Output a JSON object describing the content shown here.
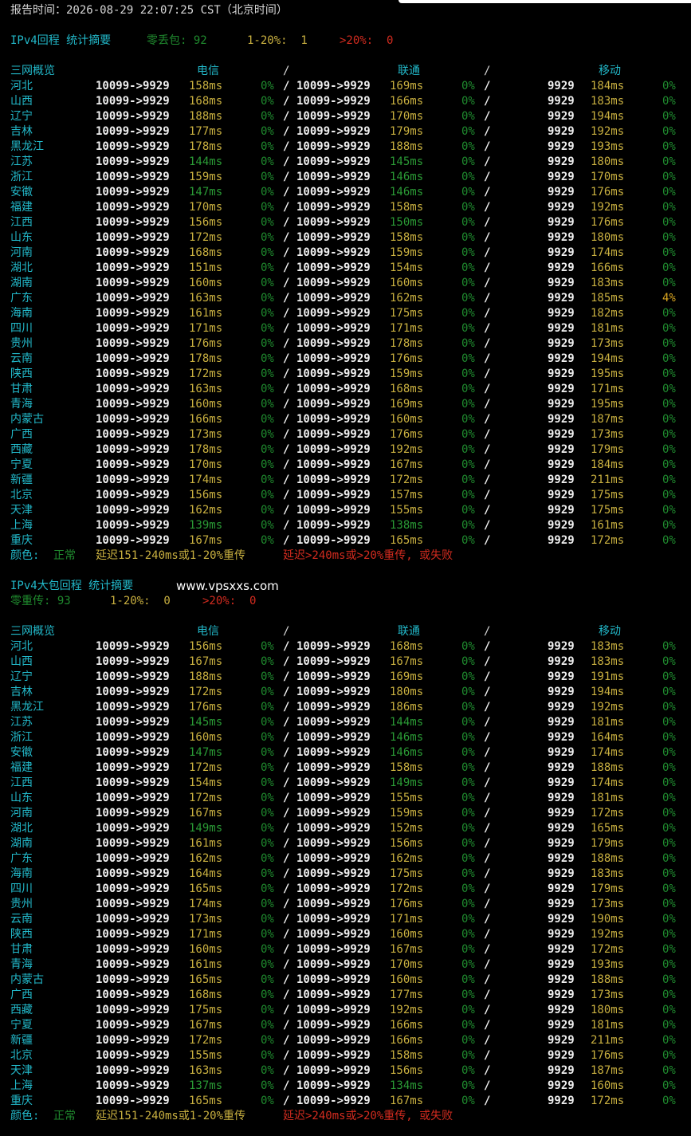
{
  "report_time": "报告时间：2026-08-29 22:07:25 CST（北京时间）",
  "section1": {
    "title": "IPv4回程 统计摘要",
    "stats": [
      {
        "label": "零丢包: 92",
        "color": "green"
      },
      {
        "label": "1-20%:  1",
        "color": "yellow"
      },
      {
        "label": ">20%:  0",
        "color": "red"
      }
    ],
    "header": {
      "region": "三网概览",
      "telecom": "电信",
      "sep1": "/",
      "unicom": "联通",
      "sep2": "/",
      "mobile": "移动"
    },
    "rows": [
      [
        "河北",
        "10099->9929",
        "158ms",
        "0%",
        "10099->9929",
        "169ms",
        "0%",
        "9929",
        "184ms",
        "0%"
      ],
      [
        "山西",
        "10099->9929",
        "168ms",
        "0%",
        "10099->9929",
        "166ms",
        "0%",
        "9929",
        "183ms",
        "0%"
      ],
      [
        "辽宁",
        "10099->9929",
        "188ms",
        "0%",
        "10099->9929",
        "170ms",
        "0%",
        "9929",
        "194ms",
        "0%"
      ],
      [
        "吉林",
        "10099->9929",
        "177ms",
        "0%",
        "10099->9929",
        "179ms",
        "0%",
        "9929",
        "192ms",
        "0%"
      ],
      [
        "黑龙江",
        "10099->9929",
        "178ms",
        "0%",
        "10099->9929",
        "188ms",
        "0%",
        "9929",
        "193ms",
        "0%"
      ],
      [
        "江苏",
        "10099->9929",
        "144ms",
        "0%",
        "10099->9929",
        "145ms",
        "0%",
        "9929",
        "180ms",
        "0%"
      ],
      [
        "浙江",
        "10099->9929",
        "159ms",
        "0%",
        "10099->9929",
        "146ms",
        "0%",
        "9929",
        "170ms",
        "0%"
      ],
      [
        "安徽",
        "10099->9929",
        "147ms",
        "0%",
        "10099->9929",
        "146ms",
        "0%",
        "9929",
        "176ms",
        "0%"
      ],
      [
        "福建",
        "10099->9929",
        "170ms",
        "0%",
        "10099->9929",
        "158ms",
        "0%",
        "9929",
        "192ms",
        "0%"
      ],
      [
        "江西",
        "10099->9929",
        "156ms",
        "0%",
        "10099->9929",
        "150ms",
        "0%",
        "9929",
        "176ms",
        "0%"
      ],
      [
        "山东",
        "10099->9929",
        "172ms",
        "0%",
        "10099->9929",
        "158ms",
        "0%",
        "9929",
        "180ms",
        "0%"
      ],
      [
        "河南",
        "10099->9929",
        "168ms",
        "0%",
        "10099->9929",
        "159ms",
        "0%",
        "9929",
        "174ms",
        "0%"
      ],
      [
        "湖北",
        "10099->9929",
        "151ms",
        "0%",
        "10099->9929",
        "154ms",
        "0%",
        "9929",
        "166ms",
        "0%"
      ],
      [
        "湖南",
        "10099->9929",
        "160ms",
        "0%",
        "10099->9929",
        "160ms",
        "0%",
        "9929",
        "183ms",
        "0%"
      ],
      [
        "广东",
        "10099->9929",
        "163ms",
        "0%",
        "10099->9929",
        "162ms",
        "0%",
        "9929",
        "185ms",
        "4%"
      ],
      [
        "海南",
        "10099->9929",
        "161ms",
        "0%",
        "10099->9929",
        "175ms",
        "0%",
        "9929",
        "182ms",
        "0%"
      ],
      [
        "四川",
        "10099->9929",
        "171ms",
        "0%",
        "10099->9929",
        "171ms",
        "0%",
        "9929",
        "181ms",
        "0%"
      ],
      [
        "贵州",
        "10099->9929",
        "176ms",
        "0%",
        "10099->9929",
        "178ms",
        "0%",
        "9929",
        "173ms",
        "0%"
      ],
      [
        "云南",
        "10099->9929",
        "178ms",
        "0%",
        "10099->9929",
        "176ms",
        "0%",
        "9929",
        "194ms",
        "0%"
      ],
      [
        "陕西",
        "10099->9929",
        "172ms",
        "0%",
        "10099->9929",
        "159ms",
        "0%",
        "9929",
        "195ms",
        "0%"
      ],
      [
        "甘肃",
        "10099->9929",
        "163ms",
        "0%",
        "10099->9929",
        "168ms",
        "0%",
        "9929",
        "171ms",
        "0%"
      ],
      [
        "青海",
        "10099->9929",
        "160ms",
        "0%",
        "10099->9929",
        "169ms",
        "0%",
        "9929",
        "195ms",
        "0%"
      ],
      [
        "内蒙古",
        "10099->9929",
        "166ms",
        "0%",
        "10099->9929",
        "160ms",
        "0%",
        "9929",
        "187ms",
        "0%"
      ],
      [
        "广西",
        "10099->9929",
        "173ms",
        "0%",
        "10099->9929",
        "176ms",
        "0%",
        "9929",
        "173ms",
        "0%"
      ],
      [
        "西藏",
        "10099->9929",
        "178ms",
        "0%",
        "10099->9929",
        "192ms",
        "0%",
        "9929",
        "179ms",
        "0%"
      ],
      [
        "宁夏",
        "10099->9929",
        "170ms",
        "0%",
        "10099->9929",
        "167ms",
        "0%",
        "9929",
        "184ms",
        "0%"
      ],
      [
        "新疆",
        "10099->9929",
        "174ms",
        "0%",
        "10099->9929",
        "172ms",
        "0%",
        "9929",
        "211ms",
        "0%"
      ],
      [
        "北京",
        "10099->9929",
        "156ms",
        "0%",
        "10099->9929",
        "157ms",
        "0%",
        "9929",
        "175ms",
        "0%"
      ],
      [
        "天津",
        "10099->9929",
        "162ms",
        "0%",
        "10099->9929",
        "155ms",
        "0%",
        "9929",
        "175ms",
        "0%"
      ],
      [
        "上海",
        "10099->9929",
        "139ms",
        "0%",
        "10099->9929",
        "138ms",
        "0%",
        "9929",
        "161ms",
        "0%"
      ],
      [
        "重庆",
        "10099->9929",
        "167ms",
        "0%",
        "10099->9929",
        "165ms",
        "0%",
        "9929",
        "172ms",
        "0%"
      ]
    ]
  },
  "legend": {
    "prefix": "颜色:",
    "normal": "正常",
    "warn": "延迟151-240ms或1-20%重传",
    "bad": "延迟>240ms或>20%重传, 或失败"
  },
  "section2": {
    "title": "IPv4大包回程 统计摘要",
    "website": "www.vpsxxs.com",
    "stats": [
      {
        "label": "零重传: 93",
        "color": "green"
      },
      {
        "label": "1-20%:  0",
        "color": "yellow"
      },
      {
        "label": ">20%:  0",
        "color": "red"
      }
    ],
    "header": {
      "region": "三网概览",
      "telecom": "电信",
      "sep1": "/",
      "unicom": "联通",
      "sep2": "/",
      "mobile": "移动"
    },
    "rows": [
      [
        "河北",
        "10099->9929",
        "156ms",
        "0%",
        "10099->9929",
        "168ms",
        "0%",
        "9929",
        "183ms",
        "0%"
      ],
      [
        "山西",
        "10099->9929",
        "167ms",
        "0%",
        "10099->9929",
        "167ms",
        "0%",
        "9929",
        "183ms",
        "0%"
      ],
      [
        "辽宁",
        "10099->9929",
        "188ms",
        "0%",
        "10099->9929",
        "169ms",
        "0%",
        "9929",
        "191ms",
        "0%"
      ],
      [
        "吉林",
        "10099->9929",
        "172ms",
        "0%",
        "10099->9929",
        "180ms",
        "0%",
        "9929",
        "194ms",
        "0%"
      ],
      [
        "黑龙江",
        "10099->9929",
        "176ms",
        "0%",
        "10099->9929",
        "186ms",
        "0%",
        "9929",
        "192ms",
        "0%"
      ],
      [
        "江苏",
        "10099->9929",
        "145ms",
        "0%",
        "10099->9929",
        "144ms",
        "0%",
        "9929",
        "181ms",
        "0%"
      ],
      [
        "浙江",
        "10099->9929",
        "160ms",
        "0%",
        "10099->9929",
        "146ms",
        "0%",
        "9929",
        "164ms",
        "0%"
      ],
      [
        "安徽",
        "10099->9929",
        "147ms",
        "0%",
        "10099->9929",
        "146ms",
        "0%",
        "9929",
        "174ms",
        "0%"
      ],
      [
        "福建",
        "10099->9929",
        "172ms",
        "0%",
        "10099->9929",
        "158ms",
        "0%",
        "9929",
        "188ms",
        "0%"
      ],
      [
        "江西",
        "10099->9929",
        "154ms",
        "0%",
        "10099->9929",
        "149ms",
        "0%",
        "9929",
        "174ms",
        "0%"
      ],
      [
        "山东",
        "10099->9929",
        "172ms",
        "0%",
        "10099->9929",
        "155ms",
        "0%",
        "9929",
        "181ms",
        "0%"
      ],
      [
        "河南",
        "10099->9929",
        "167ms",
        "0%",
        "10099->9929",
        "159ms",
        "0%",
        "9929",
        "172ms",
        "0%"
      ],
      [
        "湖北",
        "10099->9929",
        "149ms",
        "0%",
        "10099->9929",
        "152ms",
        "0%",
        "9929",
        "165ms",
        "0%"
      ],
      [
        "湖南",
        "10099->9929",
        "161ms",
        "0%",
        "10099->9929",
        "156ms",
        "0%",
        "9929",
        "179ms",
        "0%"
      ],
      [
        "广东",
        "10099->9929",
        "162ms",
        "0%",
        "10099->9929",
        "162ms",
        "0%",
        "9929",
        "188ms",
        "0%"
      ],
      [
        "海南",
        "10099->9929",
        "164ms",
        "0%",
        "10099->9929",
        "175ms",
        "0%",
        "9929",
        "183ms",
        "0%"
      ],
      [
        "四川",
        "10099->9929",
        "165ms",
        "0%",
        "10099->9929",
        "172ms",
        "0%",
        "9929",
        "179ms",
        "0%"
      ],
      [
        "贵州",
        "10099->9929",
        "174ms",
        "0%",
        "10099->9929",
        "176ms",
        "0%",
        "9929",
        "173ms",
        "0%"
      ],
      [
        "云南",
        "10099->9929",
        "173ms",
        "0%",
        "10099->9929",
        "171ms",
        "0%",
        "9929",
        "190ms",
        "0%"
      ],
      [
        "陕西",
        "10099->9929",
        "171ms",
        "0%",
        "10099->9929",
        "160ms",
        "0%",
        "9929",
        "192ms",
        "0%"
      ],
      [
        "甘肃",
        "10099->9929",
        "160ms",
        "0%",
        "10099->9929",
        "167ms",
        "0%",
        "9929",
        "172ms",
        "0%"
      ],
      [
        "青海",
        "10099->9929",
        "161ms",
        "0%",
        "10099->9929",
        "170ms",
        "0%",
        "9929",
        "193ms",
        "0%"
      ],
      [
        "内蒙古",
        "10099->9929",
        "165ms",
        "0%",
        "10099->9929",
        "160ms",
        "0%",
        "9929",
        "188ms",
        "0%"
      ],
      [
        "广西",
        "10099->9929",
        "168ms",
        "0%",
        "10099->9929",
        "177ms",
        "0%",
        "9929",
        "173ms",
        "0%"
      ],
      [
        "西藏",
        "10099->9929",
        "175ms",
        "0%",
        "10099->9929",
        "192ms",
        "0%",
        "9929",
        "180ms",
        "0%"
      ],
      [
        "宁夏",
        "10099->9929",
        "167ms",
        "0%",
        "10099->9929",
        "166ms",
        "0%",
        "9929",
        "181ms",
        "0%"
      ],
      [
        "新疆",
        "10099->9929",
        "172ms",
        "0%",
        "10099->9929",
        "166ms",
        "0%",
        "9929",
        "211ms",
        "0%"
      ],
      [
        "北京",
        "10099->9929",
        "155ms",
        "0%",
        "10099->9929",
        "158ms",
        "0%",
        "9929",
        "176ms",
        "0%"
      ],
      [
        "天津",
        "10099->9929",
        "163ms",
        "0%",
        "10099->9929",
        "156ms",
        "0%",
        "9929",
        "187ms",
        "0%"
      ],
      [
        "上海",
        "10099->9929",
        "137ms",
        "0%",
        "10099->9929",
        "134ms",
        "0%",
        "9929",
        "160ms",
        "0%"
      ],
      [
        "重庆",
        "10099->9929",
        "165ms",
        "0%",
        "10099->9929",
        "167ms",
        "0%",
        "9929",
        "172ms",
        "0%"
      ]
    ]
  }
}
